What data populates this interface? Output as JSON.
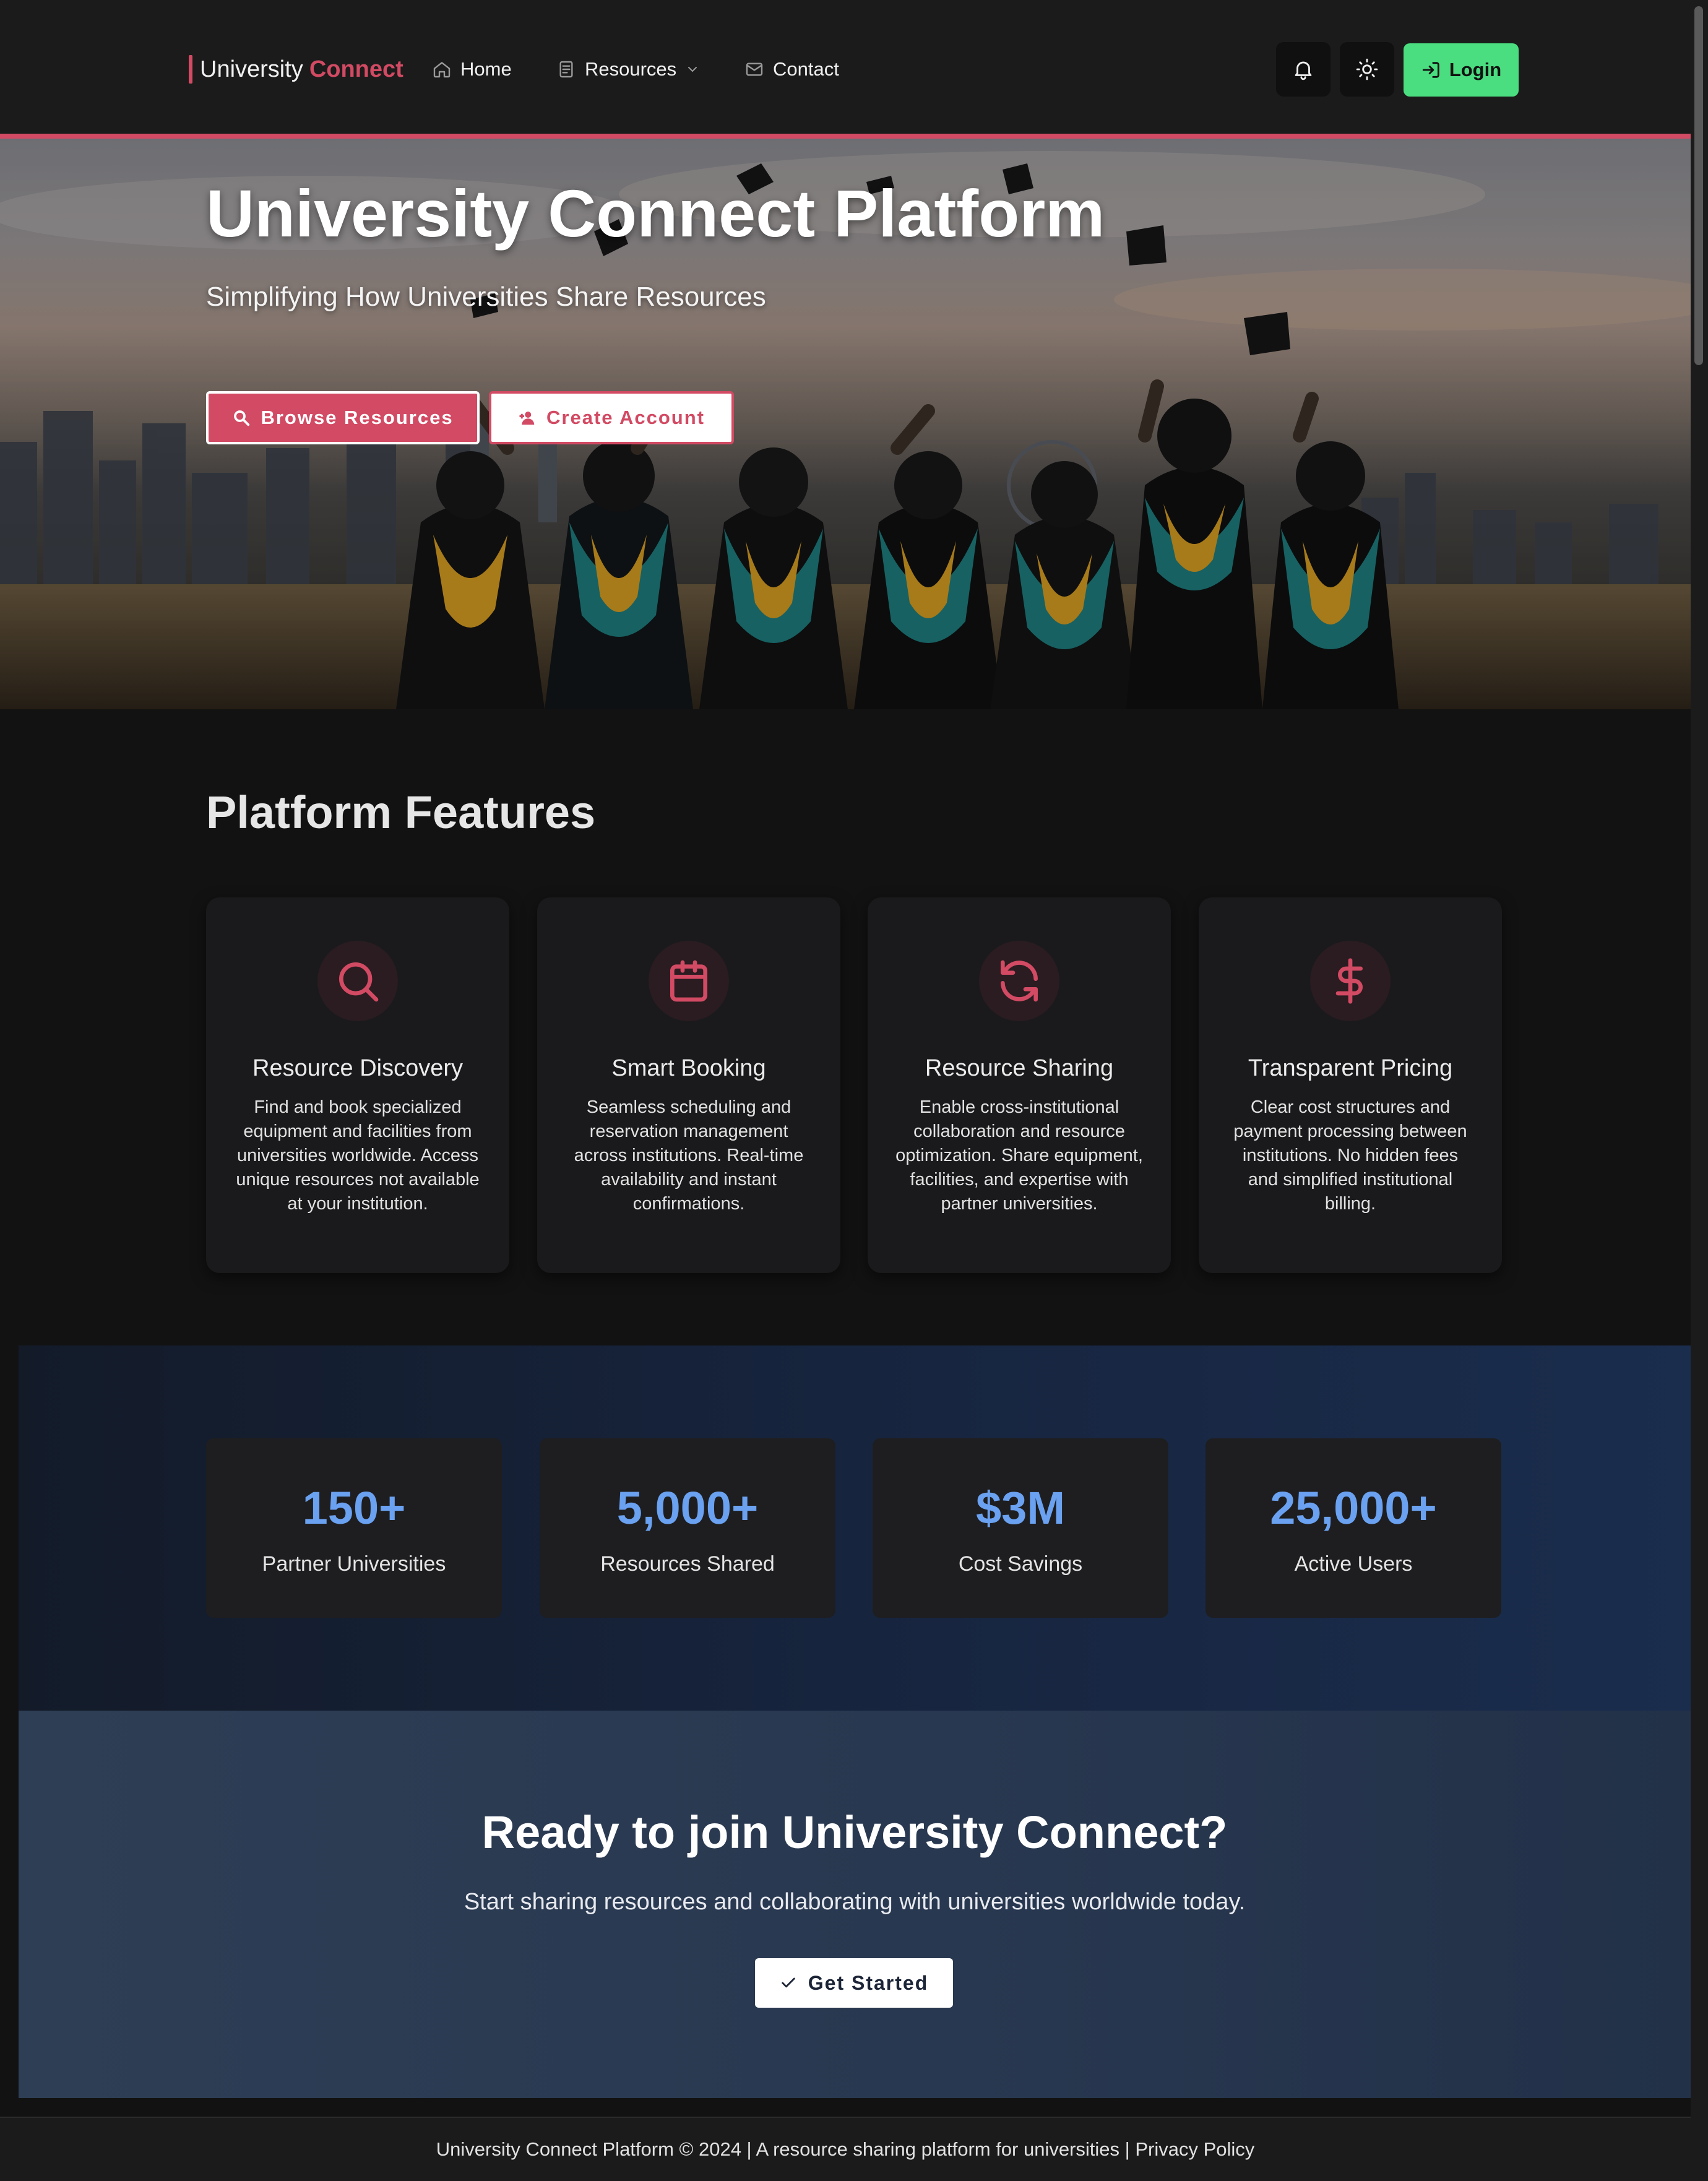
{
  "nav": {
    "brand_prefix": "University",
    "brand_accent": "Connect",
    "links": [
      {
        "label": "Home",
        "icon": "home-icon"
      },
      {
        "label": "Resources",
        "icon": "document-icon",
        "has_dropdown": true
      },
      {
        "label": "Contact",
        "icon": "mail-icon"
      }
    ],
    "notifications_icon": "bell-icon",
    "theme_toggle_icon": "sun-icon",
    "login_label": "Login",
    "login_icon": "login-arrow-icon"
  },
  "hero": {
    "title": "University Connect Platform",
    "subtitle": "Simplifying How Universities Share Resources",
    "primary_button": "Browse Resources",
    "secondary_button": "Create Account",
    "background": "photo of graduates throwing caps in front of a city skyline"
  },
  "features": {
    "heading": "Platform Features",
    "items": [
      {
        "icon": "search-icon",
        "title": "Resource Discovery",
        "description": "Find and book specialized equipment and facilities from universities worldwide. Access unique resources not available at your institution."
      },
      {
        "icon": "calendar-icon",
        "title": "Smart Booking",
        "description": "Seamless scheduling and reservation management across institutions. Real-time availability and instant confirmations."
      },
      {
        "icon": "sync-icon",
        "title": "Resource Sharing",
        "description": "Enable cross-institutional collaboration and resource optimization. Share equipment, facilities, and expertise with partner universities."
      },
      {
        "icon": "dollar-icon",
        "title": "Transparent Pricing",
        "description": "Clear cost structures and payment processing between institutions. No hidden fees and simplified institutional billing."
      }
    ]
  },
  "stats": [
    {
      "value": "150+",
      "label": "Partner Universities"
    },
    {
      "value": "5,000+",
      "label": "Resources Shared"
    },
    {
      "value": "$3M",
      "label": "Cost Savings"
    },
    {
      "value": "25,000+",
      "label": "Active Users"
    }
  ],
  "cta": {
    "title": "Ready to join University Connect?",
    "text": "Start sharing resources and collaborating with universities worldwide today.",
    "button": "Get Started"
  },
  "footer": {
    "text": "University Connect Platform © 2024 | A resource sharing platform for universities | Privacy Policy"
  },
  "colors": {
    "accent": "#d24a63",
    "login": "#4ade80",
    "stat_value": "#6aa1f0"
  }
}
